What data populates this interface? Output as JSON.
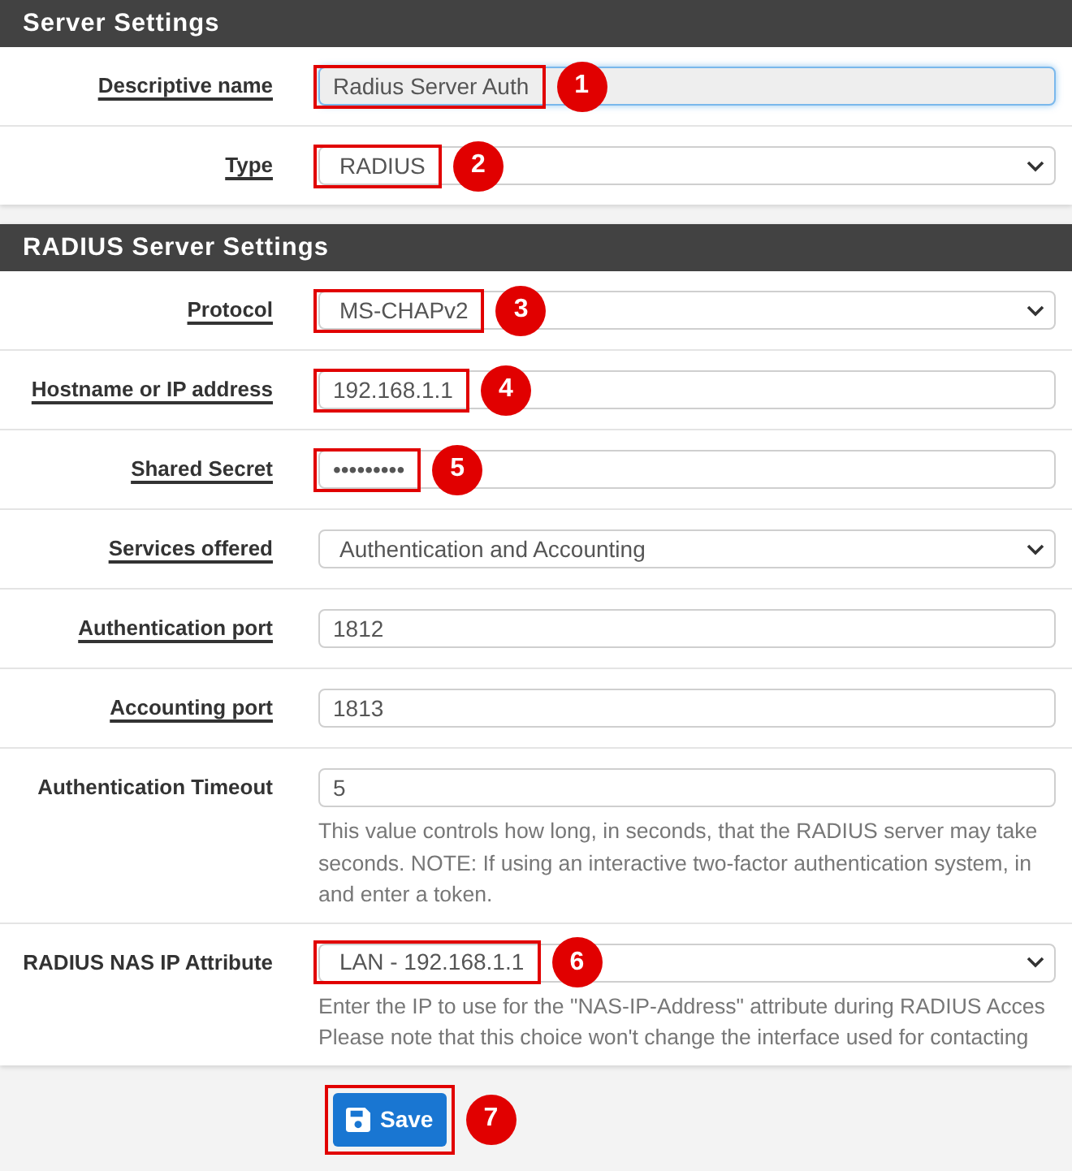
{
  "sections": [
    {
      "title": "Server Settings",
      "fields": [
        {
          "label": "Descriptive name",
          "label_link": true,
          "kind": "text",
          "value": "Radius Server Auth",
          "readonly": true,
          "focused": true,
          "callout": "1"
        },
        {
          "label": "Type",
          "label_link": true,
          "kind": "select",
          "value": "RADIUS",
          "readonly": false,
          "focused": false,
          "callout": "2"
        }
      ]
    },
    {
      "title": "RADIUS Server Settings",
      "fields": [
        {
          "label": "Protocol",
          "label_link": true,
          "kind": "select",
          "value": "MS-CHAPv2",
          "readonly": false,
          "focused": false,
          "callout": "3"
        },
        {
          "label": "Hostname or IP address",
          "label_link": true,
          "kind": "text",
          "value": "192.168.1.1",
          "readonly": false,
          "focused": false,
          "callout": "4"
        },
        {
          "label": "Shared Secret",
          "label_link": true,
          "kind": "text",
          "value": "•••••••••",
          "readonly": false,
          "focused": false,
          "callout": "5"
        },
        {
          "label": "Services offered",
          "label_link": true,
          "kind": "select",
          "value": "Authentication and Accounting",
          "readonly": false,
          "focused": false
        },
        {
          "label": "Authentication port",
          "label_link": true,
          "kind": "text",
          "value": "1812",
          "readonly": false,
          "focused": false
        },
        {
          "label": "Accounting port",
          "label_link": true,
          "kind": "text",
          "value": "1813",
          "readonly": false,
          "focused": false
        },
        {
          "label": "Authentication Timeout",
          "label_link": false,
          "kind": "text",
          "value": "5",
          "readonly": false,
          "focused": false,
          "help": [
            "This value controls how long, in seconds, that the RADIUS server may take",
            "seconds. NOTE: If using an interactive two-factor authentication system, in",
            "and enter a token."
          ]
        },
        {
          "label": "RADIUS NAS IP Attribute",
          "label_link": false,
          "kind": "select",
          "value": "LAN - 192.168.1.1",
          "readonly": false,
          "focused": false,
          "callout": "6",
          "help": [
            "Enter the IP to use for the \"NAS-IP-Address\" attribute during RADIUS Acces",
            "Please note that this choice won't change the interface used for contacting"
          ]
        }
      ]
    }
  ],
  "save_button": {
    "label": "Save",
    "callout": "7"
  }
}
